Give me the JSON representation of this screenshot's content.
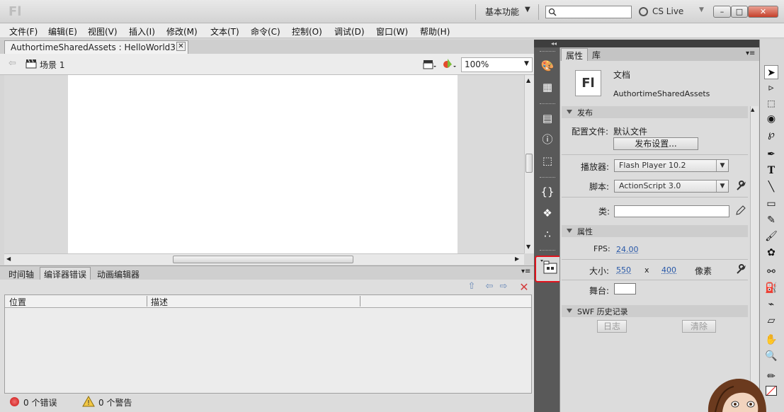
{
  "titlebar": {
    "logo": "Fl",
    "workspace": "基本功能",
    "search_placeholder": "",
    "cslive": "CS Live",
    "min": "–",
    "max": "□",
    "close": "✕"
  },
  "menu": [
    "文件(F)",
    "编辑(E)",
    "视图(V)",
    "插入(I)",
    "修改(M)",
    "文本(T)",
    "命令(C)",
    "控制(O)",
    "调试(D)",
    "窗口(W)",
    "帮助(H)"
  ],
  "document_tab": "AuthortimeSharedAssets : HelloWorld3",
  "editbar": {
    "scene": "场景 1",
    "zoom": "100%"
  },
  "bottom_tabs": [
    "时间轴",
    "编译器错误",
    "动画编辑器"
  ],
  "error_table": {
    "columns": [
      "位置",
      "描述"
    ]
  },
  "status": {
    "errors": "0 个错误",
    "warnings": "0 个警告"
  },
  "properties": {
    "tabs": [
      "属性",
      "库"
    ],
    "doc_icon": "Fl",
    "doc_type": "文档",
    "doc_name": "AuthortimeSharedAssets",
    "publish": {
      "header": "发布",
      "profile_label": "配置文件:",
      "profile_value": "默认文件",
      "settings_button": "发布设置...",
      "player_label": "播放器:",
      "player_value": "Flash Player 10.2",
      "script_label": "脚本:",
      "script_value": "ActionScript 3.0",
      "class_label": "类:",
      "class_value": ""
    },
    "props": {
      "header": "属性",
      "fps_label": "FPS:",
      "fps_value": "24.00",
      "size_label": "大小:",
      "width": "550",
      "x": "x",
      "height": "400",
      "unit": "像素",
      "stage_label": "舞台:",
      "stage_color": "#ffffff"
    },
    "swf": {
      "header": "SWF 历史记录",
      "log_button": "日志",
      "clear_button": "清除"
    }
  },
  "colors": {
    "highlight": "#e0141e",
    "link": "#2858a8",
    "dark_panel": "#595959"
  }
}
